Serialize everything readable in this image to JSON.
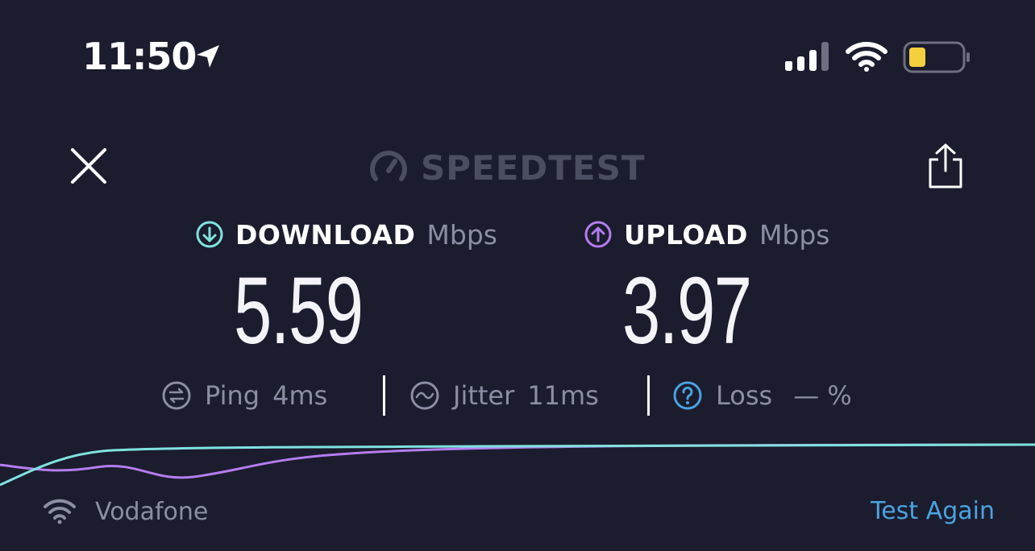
{
  "status_bar": {
    "time": "11:50",
    "icons": [
      "location-arrow-icon",
      "cellular-signal-icon",
      "wifi-icon",
      "battery-icon"
    ],
    "battery_color": "#f4d03f"
  },
  "header": {
    "logo_text": "SPEEDTEST",
    "close_icon": "close-icon",
    "share_icon": "share-icon"
  },
  "download": {
    "label": "DOWNLOAD",
    "unit": "Mbps",
    "value": "5.59",
    "icon": "download-arrow-icon",
    "color": "#7fe3de"
  },
  "upload": {
    "label": "UPLOAD",
    "unit": "Mbps",
    "value": "3.97",
    "icon": "upload-arrow-icon",
    "color": "#b57cf0"
  },
  "stats": {
    "ping_label": "Ping",
    "ping_value": "4ms",
    "jitter_label": "Jitter",
    "jitter_value": "11ms",
    "loss_label": "Loss",
    "loss_value": "— %",
    "loss_color": "#4aa3e0"
  },
  "footer": {
    "network_name": "Vodafone",
    "test_again_label": "Test Again"
  },
  "colors": {
    "background": "#1b1c2e",
    "muted": "#8c8ea3",
    "accent": "#4aa3e0"
  }
}
